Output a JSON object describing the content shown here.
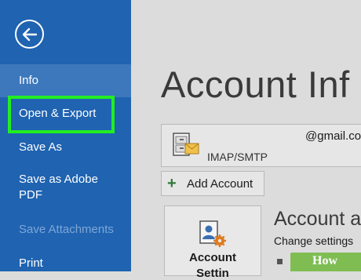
{
  "sidebar": {
    "items": [
      {
        "label": "Info"
      },
      {
        "label": "Open & Export"
      },
      {
        "label": "Save As"
      },
      {
        "label": "Save as Adobe PDF"
      },
      {
        "label": "Save Attachments"
      },
      {
        "label": "Print"
      }
    ],
    "back_icon": "arrow-left-icon"
  },
  "main": {
    "title": "Account Inf",
    "account": {
      "email": "@gmail.co",
      "type": "IMAP/SMTP",
      "icon": "mail-account-icon"
    },
    "add_account_label": "Add Account",
    "settings_tile": {
      "label_line1": "Account",
      "label_line2": "Settin",
      "icon": "account-settings-icon"
    },
    "section_heading": "Account a",
    "section_desc": "Change settings"
  },
  "badge": {
    "text": "How"
  },
  "colors": {
    "sidebar_bg": "#1f63b1",
    "sidebar_selected": "#3d78bd",
    "highlight": "#22ee22",
    "main_bg": "#dcdcdc",
    "badge_bg": "#7fbd53"
  }
}
